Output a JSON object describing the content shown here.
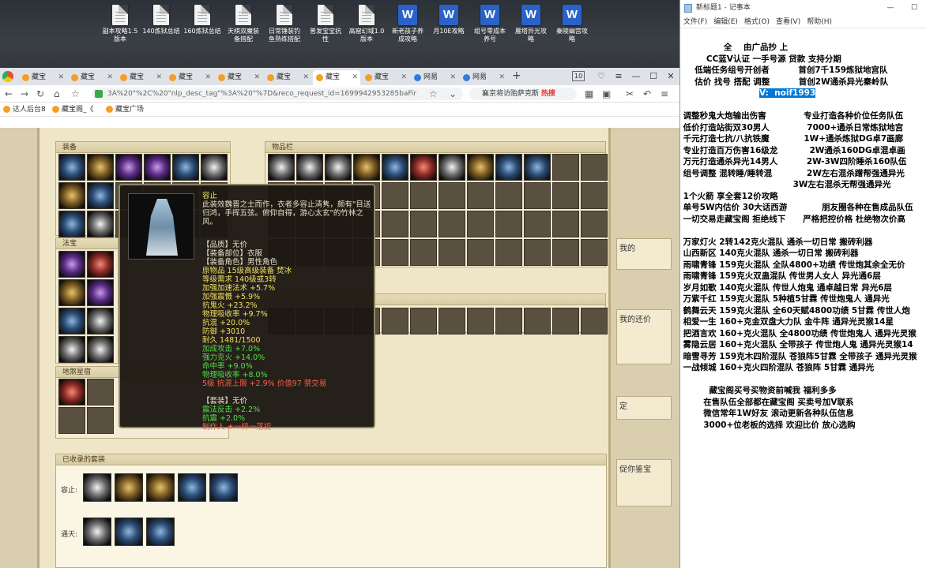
{
  "desktop": {
    "icons": [
      {
        "label": "副本攻略1.5\n版本",
        "type": "file"
      },
      {
        "label": "140炼狱总结",
        "type": "file"
      },
      {
        "label": "160炼狱总结",
        "type": "file"
      },
      {
        "label": "天棋双魔装\n备搭配",
        "type": "file"
      },
      {
        "label": "日常锤装钓\n鱼熟练搭配",
        "type": "file"
      },
      {
        "label": "普发宝宝抗\n性",
        "type": "file"
      },
      {
        "label": "高窟幻域1.0\n版本",
        "type": "file"
      },
      {
        "label": "新老孩子养\n成攻略",
        "type": "word"
      },
      {
        "label": "月10E攻略",
        "type": "word"
      },
      {
        "label": "组号零成本\n养号",
        "type": "word"
      },
      {
        "label": "雁塔异光攻\n略",
        "type": "word"
      },
      {
        "label": "秦陵幽宫攻\n略",
        "type": "word"
      }
    ]
  },
  "browser": {
    "tabs": [
      "藏宝",
      "藏宝",
      "藏宝",
      "藏宝",
      "藏宝",
      "藏宝",
      "藏宝",
      "藏宝",
      "网易",
      "网易"
    ],
    "tab_count": "10",
    "url": "3A%20\"%2C%20\"nlp_desc_tag\"%3A%20\"%7D&reco_request_id=1699942953285baFir",
    "search_text": "襄京将访贻萨克斯",
    "search_hot": "热搜",
    "bookmarks": [
      "达人后台8",
      "藏宝阁_《",
      "藏宝广场"
    ]
  },
  "game": {
    "equip_header": "装备",
    "fabao_header": "法宝",
    "lingshi_header": "地煞星宿",
    "bag_header": "物品栏",
    "suit_header": "已收录的套装",
    "suit_rows": [
      {
        "label": "容止:"
      },
      {
        "label": "通天:"
      }
    ],
    "right_buttons": [
      "我的",
      "我的还价",
      "定",
      "促你鉴宝"
    ],
    "tooltip": {
      "name": "容止",
      "desc": "此装效魏晋之士而作，衣者多容止清隽，颇有\"目送归鸿，手挥五弦。俯仰自得，游心太玄\"的竹林之风。",
      "lines": [
        {
          "text": "【品质】无价",
          "color": "white"
        },
        {
          "text": "【装备部位】衣服",
          "color": "white"
        },
        {
          "text": "【装备角色】男性角色",
          "color": "white"
        },
        {
          "text": "原物品 15级高级装备 焚冰",
          "color": "yellow"
        },
        {
          "text": "等级需求 140级或3转",
          "color": "yellow"
        },
        {
          "text": "加强加速法术 +5.7%",
          "color": "yellow"
        },
        {
          "text": "加强震慑 +5.9%",
          "color": "yellow"
        },
        {
          "text": "抗鬼火 +23.2%",
          "color": "yellow"
        },
        {
          "text": "物理吸收率 +9.7%",
          "color": "yellow"
        },
        {
          "text": "抗混 +20.0%",
          "color": "yellow"
        },
        {
          "text": "防御 +3010",
          "color": "yellow"
        },
        {
          "text": "耐久 1481/1500",
          "color": "yellow"
        },
        {
          "text": "加成攻击 +7.0%",
          "color": "green"
        },
        {
          "text": "强力克火 +14.0%",
          "color": "green"
        },
        {
          "text": "命中率 +9.0%",
          "color": "green"
        },
        {
          "text": "物理吸收率 +8.0%",
          "color": "green"
        },
        {
          "text": "5级 抗混上限 +2.9% 价值97 禁交易",
          "color": "red"
        },
        {
          "text": "",
          "color": "white"
        },
        {
          "text": "【套装】无价",
          "color": "white"
        },
        {
          "text": "震法反击 +2.2%",
          "color": "green"
        },
        {
          "text": "抗震 +2.0%",
          "color": "green"
        },
        {
          "text": "制作人 ★一枰一落捉",
          "color": "red"
        }
      ]
    }
  },
  "notepad": {
    "title": "新标题1 - 记事本",
    "menu": [
      "文件(F)",
      "编辑(E)",
      "格式(O)",
      "查看(V)",
      "帮助(H)"
    ],
    "lines": [
      "               全    由广品抄 上",
      "         CC蓝V认证 一手号源 贷款 支持分期",
      "     低端任务组号开创者          首创7千159炼狱地宫队",
      "     估价 找号 搭配 调整          首创2W通杀异光秦岭队",
      "V:  noif1993",
      "",
      " 调整秒鬼大炮输出伤害             专业打造各种价位任务队伍",
      " 低价打造站街双30男人             7000+通杀日常炼狱地宫",
      " 千元打造七抗/八抗铁魔            1W+通杀炼狱DG卓7画廊",
      " 专业打造百万伤害16级龙           2W通杀160DG卓混卓画",
      " 万元打造通杀异光14男人          2W-3W四阶睡杀160队伍",
      " 组号调整 混转睡/睡转混            2W左右混杀蹭帮强通异光",
      "                                       3W左右混杀无帮强通异光",
      " 1个火箭 享全套12价攻略",
      " 单号5W内估价 30大话西游            朋友圈各种在售成品队伍",
      " 一切交易走藏宝阁 拒绝线下      严格把控价格 杜绝物次价高",
      "",
      " 万家灯火 2转142克火混队 通杀一切日常 搬砖利器",
      " 山西新区 140克火混队 通杀一切日常 搬砖利器",
      " 雨啸青锋 159克火混队 全队4800+功绩 传世炮其余全无价",
      " 雨啸青锋 159克火双蛊混队 传世男人女人 异光通6层",
      " 岁月如歌 140克火混队 传世人炮鬼 通卓越日常 异光6层",
      " 万紫千红 159克火混队 5种植5甘霖 传世炮鬼人 通异光",
      " 鹤舞云天 159克火混队 全60天赋4800功绩 5甘霖 传世人炮",
      " 相爱一生 160+克金双盘大力队 金牛阵 通异光灵猴14星",
      " 把酒言欢 160+克火混队 全4800功绩 传世炮鬼人 通异光灵猴",
      " 雾隐云居 160+克火混队 全带孩子 传世炮人鬼 通异光灵猴14",
      " 暗雪寻芳 159克木四阶混队 苍狼阵5甘霖 全带孩子 通异光灵猴",
      " 一战倾城 160+克火四阶混队 苍狼阵 5甘霖 通异光",
      "",
      "          藏宝阁买号买物资前喊我 福利多多",
      "        在售队伍全部都在藏宝阁 买卖号加V联系",
      "        微信常年1W好友 滚动更新各种队伍信息",
      "        3000+位老板的选择 欢迎比价 放心选购"
    ],
    "selected_line_index": 4
  }
}
